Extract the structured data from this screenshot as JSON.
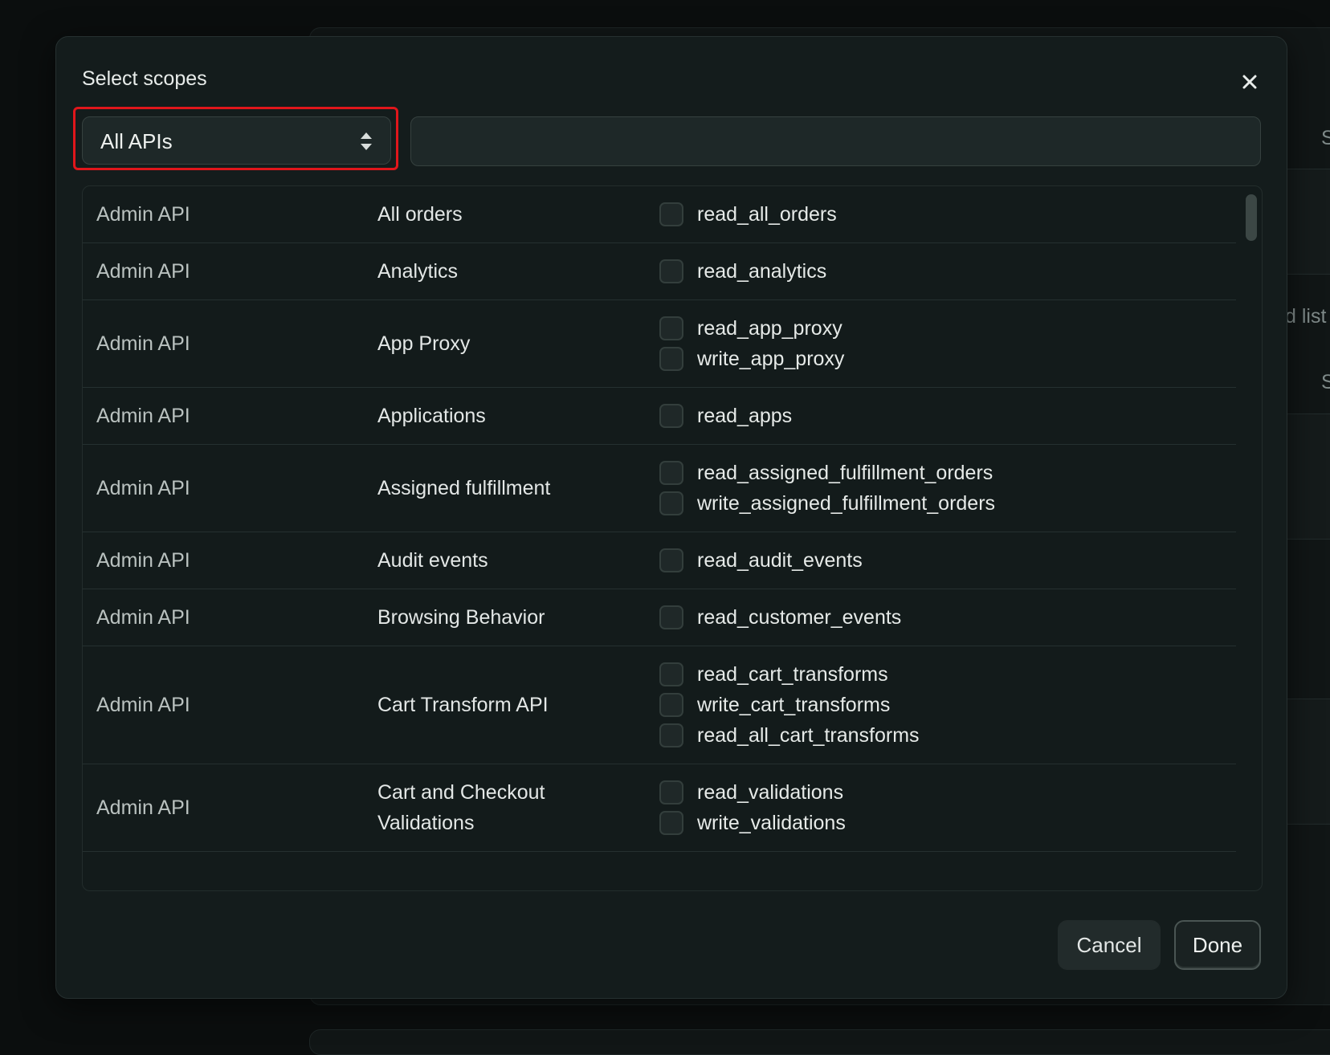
{
  "modal": {
    "title": "Select scopes",
    "close_icon": "close-icon"
  },
  "filter": {
    "api_select_value": "All APIs",
    "api_select_icon": "up-down-arrows-icon",
    "search_value": "",
    "search_placeholder": ""
  },
  "scope_rows": [
    {
      "api": "Admin API",
      "name": "All orders",
      "scopes": [
        "read_all_orders"
      ]
    },
    {
      "api": "Admin API",
      "name": "Analytics",
      "scopes": [
        "read_analytics"
      ]
    },
    {
      "api": "Admin API",
      "name": "App Proxy",
      "scopes": [
        "read_app_proxy",
        "write_app_proxy"
      ]
    },
    {
      "api": "Admin API",
      "name": "Applications",
      "scopes": [
        "read_apps"
      ]
    },
    {
      "api": "Admin API",
      "name": "Assigned fulfillment",
      "scopes": [
        "read_assigned_fulfillment_orders",
        "write_assigned_fulfillment_orders"
      ]
    },
    {
      "api": "Admin API",
      "name": "Audit events",
      "scopes": [
        "read_audit_events"
      ]
    },
    {
      "api": "Admin API",
      "name": "Browsing Behavior",
      "scopes": [
        "read_customer_events"
      ]
    },
    {
      "api": "Admin API",
      "name": "Cart Transform API",
      "scopes": [
        "read_cart_transforms",
        "write_cart_transforms",
        "read_all_cart_transforms"
      ]
    },
    {
      "api": "Admin API",
      "name": "Cart and Checkout Validations",
      "scopes": [
        "read_validations",
        "write_validations"
      ]
    }
  ],
  "footer": {
    "cancel_label": "Cancel",
    "done_label": "Done"
  },
  "background": {
    "fragment_1": "S",
    "fragment_2": "d list",
    "fragment_3": "S"
  },
  "colors": {
    "highlight": "#e0161b",
    "modal_bg": "#141c1c",
    "page_bg": "#0b0e0e"
  }
}
